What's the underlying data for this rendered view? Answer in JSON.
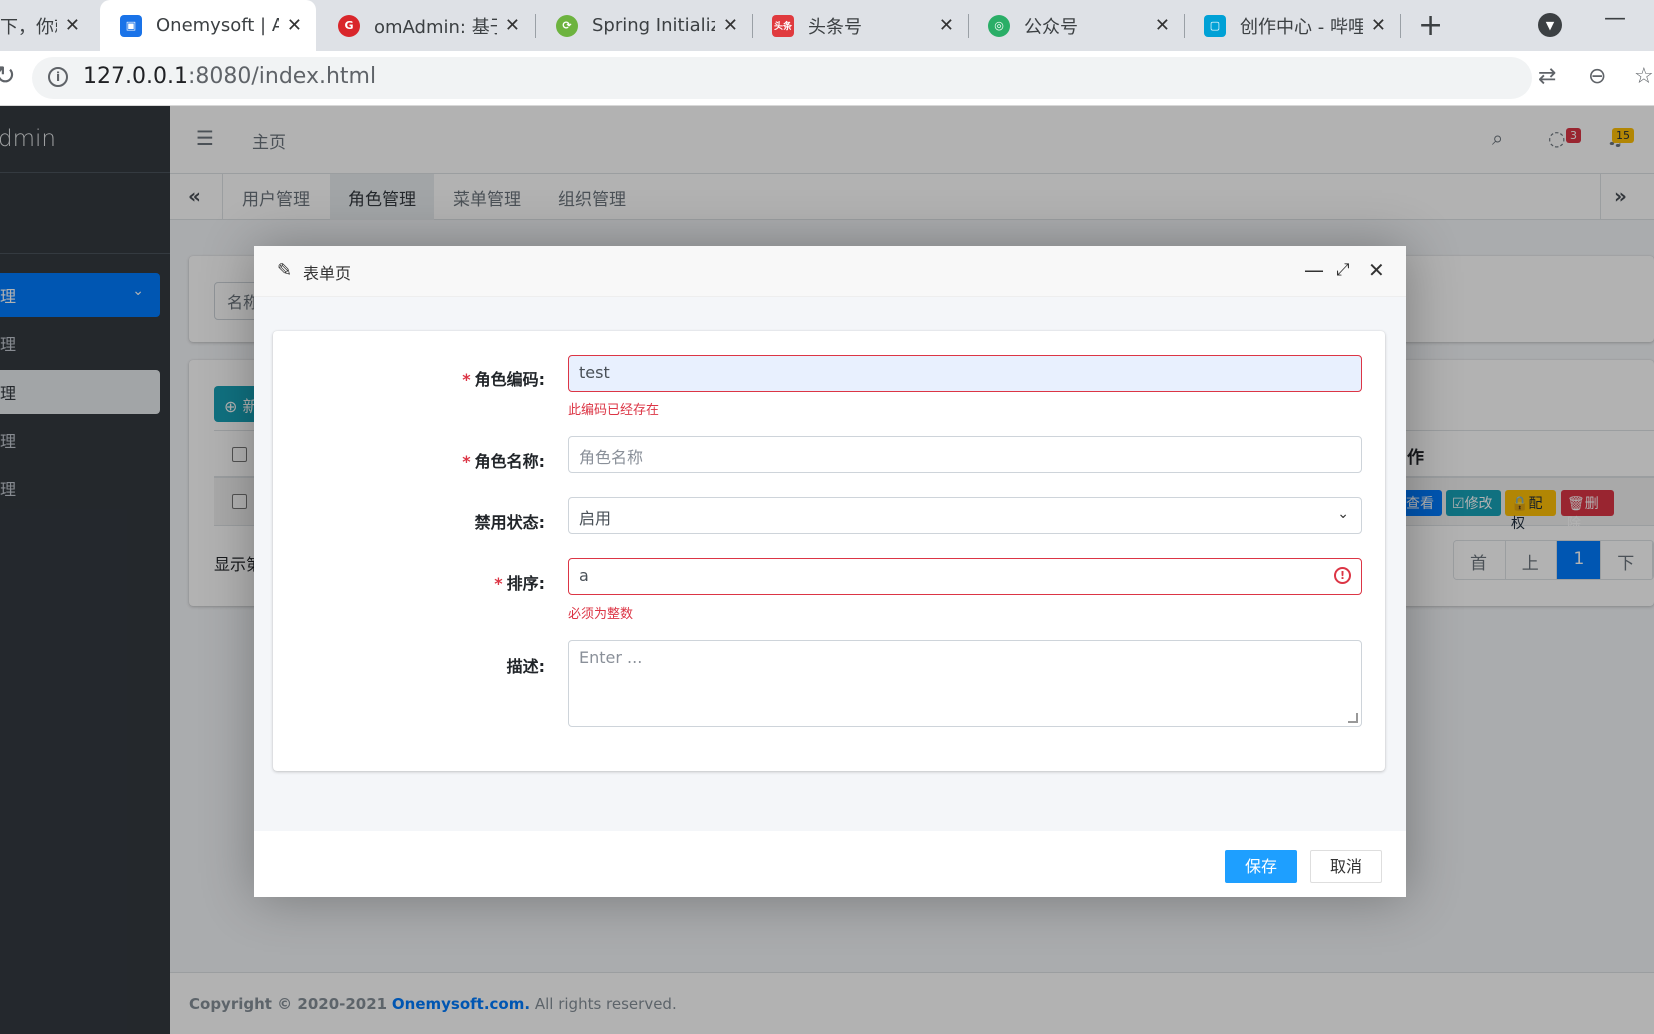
{
  "browser": {
    "tabs": [
      {
        "title": "下，你就",
        "favicon_color": "#dee1e6",
        "favicon_glyph": ""
      },
      {
        "title": "Onemysoft | A",
        "favicon_color": "#1a73e8",
        "favicon_glyph": "▣",
        "active": true
      },
      {
        "title": "omAdmin: 基于",
        "favicon_color": "#d9262b",
        "favicon_glyph": "G"
      },
      {
        "title": "Spring Initializ",
        "favicon_color": "#6db33f",
        "favicon_glyph": "⟳"
      },
      {
        "title": "头条号",
        "favicon_color": "#e03a3e",
        "favicon_glyph": "头条"
      },
      {
        "title": "公众号",
        "favicon_color": "#2aae67",
        "favicon_glyph": "◎"
      },
      {
        "title": "创作中心 - 哔哩",
        "favicon_color": "#00a1d6",
        "favicon_glyph": "▢"
      }
    ],
    "close_glyph": "✕",
    "new_tab_glyph": "+",
    "url_host": "127.0.0.1",
    "url_rest": ":8080/index.html"
  },
  "sidebar": {
    "brand": "dmin",
    "items": [
      {
        "label": "理",
        "state": "active"
      },
      {
        "label": "理",
        "state": "normal"
      },
      {
        "label": "理",
        "state": "selected"
      },
      {
        "label": "理",
        "state": "normal"
      },
      {
        "label": "理",
        "state": "normal"
      }
    ]
  },
  "header": {
    "home": "主页",
    "message_count": "3",
    "notification_count": "15"
  },
  "content_tabs": [
    "用户管理",
    "角色管理",
    "菜单管理",
    "组织管理"
  ],
  "background": {
    "search_placeholder": "名称",
    "add_button": "新",
    "ops_header": "作",
    "ops": [
      "查看",
      "修改",
      "配权",
      "删除"
    ],
    "page_info": "显示第",
    "pager": [
      "首页",
      "上页",
      "1",
      "下页"
    ]
  },
  "footer": {
    "copyright": "Copyright © 2020-2021",
    "company": "Onemysoft.com.",
    "rights": "All rights reserved."
  },
  "modal": {
    "title": "表单页",
    "fields": {
      "code": {
        "label": "角色编码:",
        "value": "test",
        "error": "此编码已经存在"
      },
      "name": {
        "label": "角色名称:",
        "placeholder": "角色名称"
      },
      "status": {
        "label": "禁用状态:",
        "value": "启用"
      },
      "order": {
        "label": "排序:",
        "value": "a",
        "error": "必须为整数"
      },
      "desc": {
        "label": "描述:",
        "placeholder": "Enter ..."
      }
    },
    "save": "保存",
    "cancel": "取消"
  }
}
